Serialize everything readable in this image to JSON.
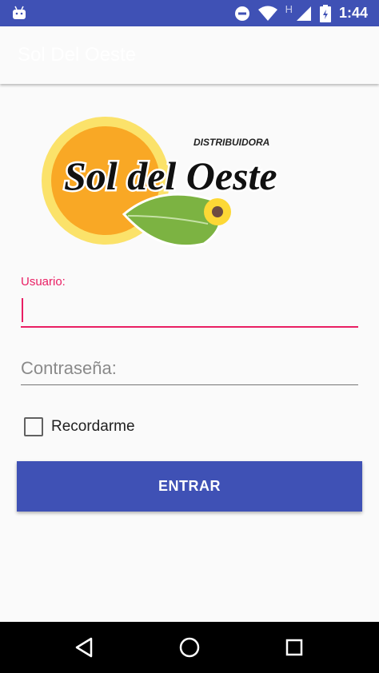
{
  "status_bar": {
    "time": "1:44",
    "network_letter": "H",
    "icons": [
      "android-icon",
      "do-not-disturb-icon",
      "wifi-icon",
      "signal-icon",
      "battery-icon"
    ]
  },
  "app_bar": {
    "title": "Sol Del Oeste"
  },
  "logo": {
    "top_text": "DISTRIBUIDORA",
    "main_text": "Sol del Oeste"
  },
  "form": {
    "user_label": "Usuario:",
    "user_value": "",
    "password_placeholder": "Contraseña:",
    "remember_label": "Recordarme",
    "remember_checked": false,
    "submit_label": "ENTRAR"
  },
  "colors": {
    "primary": "#3f51b5",
    "accent": "#e91e63",
    "sun_orange": "#f9a825",
    "leaf_green": "#7cb342"
  },
  "nav_bar": {
    "icons": [
      "back-icon",
      "home-icon",
      "recents-icon"
    ]
  }
}
